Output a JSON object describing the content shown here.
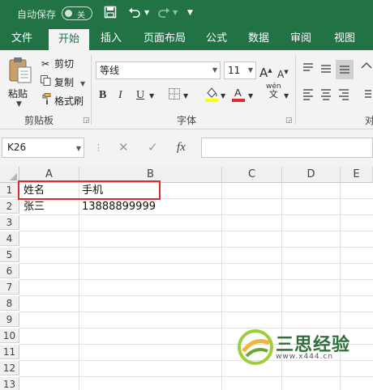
{
  "titlebar": {
    "autosave_label": "自动保存",
    "toggle_state": "关",
    "save_icon": "save-icon",
    "undo_icon": "undo-icon",
    "redo_icon": "redo-icon",
    "customize_icon": "customize-qat-icon"
  },
  "tabs": [
    "文件",
    "开始",
    "插入",
    "页面布局",
    "公式",
    "数据",
    "审阅",
    "视图"
  ],
  "active_tab": "开始",
  "ribbon": {
    "clipboard": {
      "paste_label": "粘贴",
      "cut_label": "剪切",
      "copy_label": "复制",
      "format_painter_label": "格式刷",
      "group_label": "剪贴板"
    },
    "font": {
      "font_name": "等线",
      "font_size": "11",
      "group_label": "字体",
      "grow_font": "A",
      "shrink_font": "A",
      "bold": "B",
      "italic": "I",
      "underline": "U",
      "phonetic": "wén",
      "phonetic_sub": "文"
    },
    "alignment_partial_label": "对"
  },
  "formula_bar": {
    "name_box": "K26",
    "fx": "fx",
    "formula": ""
  },
  "sheet": {
    "columns": [
      "A",
      "B",
      "C",
      "D",
      "E"
    ],
    "rows": [
      "1",
      "2",
      "3",
      "4",
      "5",
      "6",
      "7",
      "8",
      "9",
      "10",
      "11",
      "12",
      "13"
    ],
    "cells": {
      "A1": "姓名",
      "B1": "手机",
      "A2": "张三",
      "B2": "13888899999"
    }
  },
  "watermark": {
    "text": "三思经验",
    "url": "www.x444.cn"
  },
  "colors": {
    "excel_green": "#217346",
    "highlight_red": "#e0282e",
    "fill_yellow": "#ffff00",
    "font_red": "#e0282e"
  }
}
